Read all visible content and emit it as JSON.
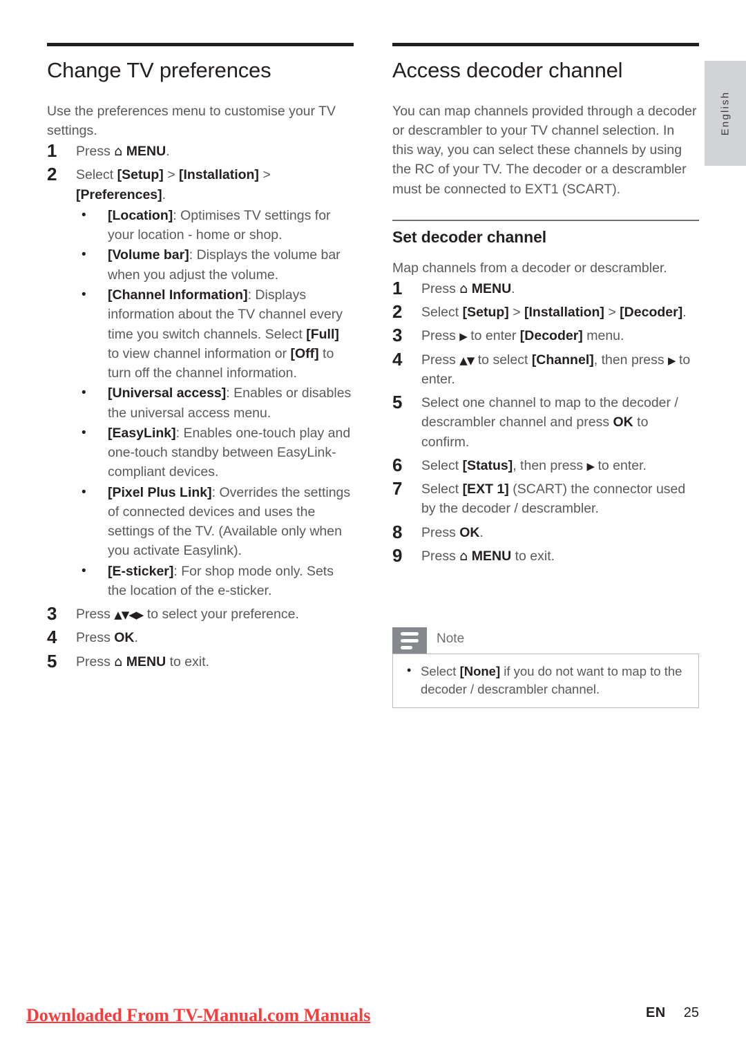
{
  "side_tab": {
    "language": "English"
  },
  "left_column": {
    "title": "Change TV preferences",
    "intro": "Use the preferences menu to customise your TV settings.",
    "steps": [
      {
        "num": "1",
        "text_parts": [
          "Press ",
          "⌂",
          " MENU",
          "."
        ]
      },
      {
        "num": "2",
        "text": "Select [Setup] > [Installation] > [Preferences]."
      },
      {
        "num": "3",
        "text": "Press ▲▼◀▶ to select your preference."
      },
      {
        "num": "4",
        "text": "Press OK."
      },
      {
        "num": "5",
        "text": "Press ⌂ MENU to exit."
      }
    ],
    "bullets": [
      {
        "term": "[Location]",
        "desc": ": Optimises TV settings for your location - home or shop."
      },
      {
        "term": "[Volume bar]",
        "desc": ": Displays the volume bar when you adjust the volume."
      },
      {
        "term": "[Channel Information]",
        "desc": ": Displays information about the TV channel every time you switch channels. Select [Full] to view channel information or [Off] to turn off the channel information."
      },
      {
        "term": "[Universal access]",
        "desc": ": Enables or disables the universal access menu."
      },
      {
        "term": "[EasyLink]",
        "desc": ": Enables one-touch play and one-touch standby between EasyLink-compliant devices."
      },
      {
        "term": "[Pixel Plus Link]",
        "desc": ": Overrides the settings of connected devices and uses the settings of the TV. (Available only when you activate Easylink)."
      },
      {
        "term": "[E-sticker]",
        "desc": ": For shop mode only. Sets the location of the e-sticker."
      }
    ]
  },
  "right_column": {
    "title": "Access decoder channel",
    "intro": "You can map channels provided through a decoder or descrambler to your TV channel selection. In this way, you can select these channels by using the RC of your TV. The decoder or a descrambler must be connected to EXT1 (SCART).",
    "subtitle": "Set decoder channel",
    "lead": "Map channels from a decoder or descrambler.",
    "steps": [
      {
        "num": "1",
        "text": "Press ⌂ MENU."
      },
      {
        "num": "2",
        "text": "Select [Setup] > [Installation] > [Decoder]."
      },
      {
        "num": "3",
        "text": "Press ▶ to enter [Decoder] menu."
      },
      {
        "num": "4",
        "text": "Press ▲▼ to select [Channel], then press ▶ to enter."
      },
      {
        "num": "5",
        "text": "Select one channel to map to the decoder / descrambler channel and press OK to confirm."
      },
      {
        "num": "6",
        "text": "Select [Status], then press ▶ to enter."
      },
      {
        "num": "7",
        "text": "Select [EXT 1] (SCART) the connector used by the decoder / descrambler."
      },
      {
        "num": "8",
        "text": "Press OK."
      },
      {
        "num": "9",
        "text": "Press ⌂ MENU to exit."
      }
    ]
  },
  "note": {
    "label": "Note",
    "items": [
      "Select [None] if you do not want to map to the decoder / descrambler channel."
    ]
  },
  "footer": {
    "watermark": "Downloaded From TV-Manual.com Manuals",
    "language_code": "EN",
    "page_number": "25"
  }
}
